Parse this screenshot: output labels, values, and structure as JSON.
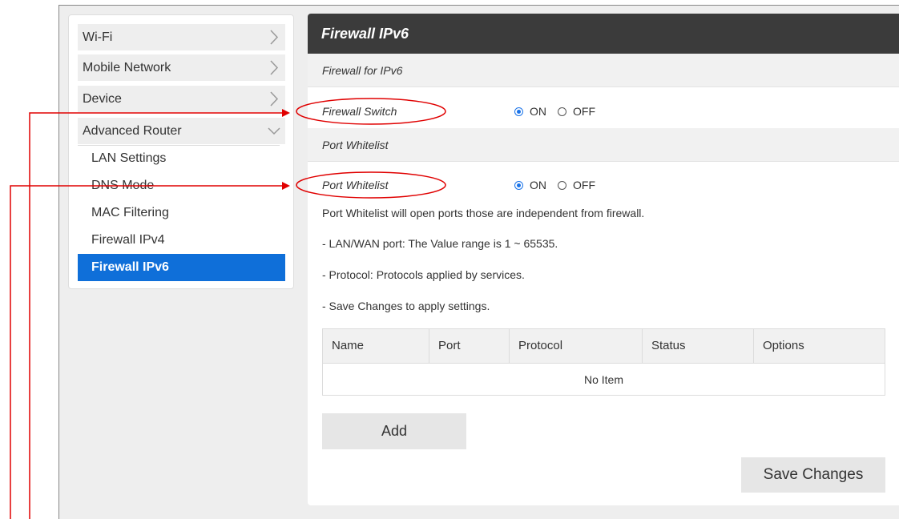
{
  "sidebar": {
    "menu": [
      {
        "label": "Wi-Fi",
        "chevron": "chevron-right-icon"
      },
      {
        "label": "Mobile Network",
        "chevron": "chevron-right-icon"
      },
      {
        "label": "Device",
        "chevron": "chevron-right-icon"
      },
      {
        "label": "Advanced Router",
        "chevron": "chevron-down-icon"
      }
    ],
    "submenu": [
      {
        "label": "LAN Settings"
      },
      {
        "label": "DNS Mode"
      },
      {
        "label": "MAC Filtering"
      },
      {
        "label": "Firewall IPv4"
      },
      {
        "label": "Firewall IPv6",
        "active": true
      }
    ]
  },
  "main": {
    "title": "Firewall IPv6",
    "section1": "Firewall for IPv6",
    "firewall_switch": {
      "label": "Firewall Switch",
      "on_label": "ON",
      "off_label": "OFF",
      "value": "ON"
    },
    "section2": "Port Whitelist",
    "port_whitelist": {
      "label": "Port Whitelist",
      "on_label": "ON",
      "off_label": "OFF",
      "value": "ON"
    },
    "descriptions": [
      "Port Whitelist will open ports those are independent from firewall.",
      "- LAN/WAN port: The Value range is 1 ~ 65535.",
      "- Protocol: Protocols applied by services.",
      "- Save Changes to apply settings."
    ],
    "table": {
      "columns": [
        "Name",
        "Port",
        "Protocol",
        "Status",
        "Options"
      ],
      "empty_text": "No Item"
    },
    "add_button": "Add",
    "save_button": "Save Changes"
  },
  "colors": {
    "accent": "#0f6fd9",
    "header_bg": "#3b3b3b",
    "annotation": "#e00000"
  }
}
